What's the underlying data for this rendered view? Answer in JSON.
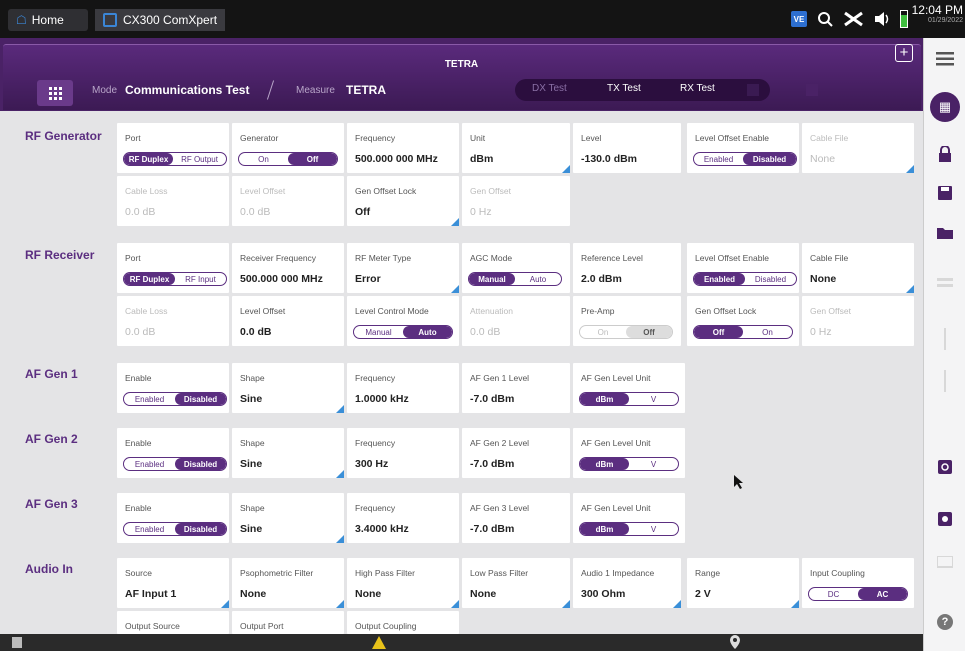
{
  "os": {
    "home_label": "Home",
    "app_label": "CX300 ComXpert",
    "time": "12:04 PM",
    "date": "01/29/2022"
  },
  "header": {
    "title": "TETRA",
    "mode_label": "Mode",
    "mode_value": "Communications Test",
    "measure_label": "Measure",
    "measure_value": "TETRA",
    "tabs": [
      "DX Test",
      "TX Test",
      "RX Test"
    ]
  },
  "sections": {
    "rf_generator": "RF Generator",
    "rf_receiver": "RF Receiver",
    "af_gen1": "AF Gen 1",
    "af_gen2": "AF Gen 2",
    "af_gen3": "AF Gen 3",
    "audio_in": "Audio In"
  },
  "rfgen": {
    "port": {
      "label": "Port",
      "opts": [
        "RF Duplex",
        "RF Output"
      ]
    },
    "generator": {
      "label": "Generator",
      "opts": [
        "On",
        "Off"
      ]
    },
    "frequency": {
      "label": "Frequency",
      "value": "500.000 000 MHz"
    },
    "unit": {
      "label": "Unit",
      "value": "dBm"
    },
    "level": {
      "label": "Level",
      "value": "-130.0 dBm"
    },
    "level_offset_enable": {
      "label": "Level Offset Enable",
      "opts": [
        "Enabled",
        "Disabled"
      ]
    },
    "cable_file": {
      "label": "Cable File",
      "value": "None"
    },
    "cable_loss": {
      "label": "Cable Loss",
      "value": "0.0 dB"
    },
    "level_offset": {
      "label": "Level Offset",
      "value": "0.0 dB"
    },
    "gen_offset_lock": {
      "label": "Gen Offset Lock",
      "value": "Off"
    },
    "gen_offset": {
      "label": "Gen Offset",
      "value": "0 Hz"
    }
  },
  "rfrec": {
    "port": {
      "label": "Port",
      "opts": [
        "RF Duplex",
        "RF Input"
      ]
    },
    "receiver_frequency": {
      "label": "Receiver Frequency",
      "value": "500.000 000 MHz"
    },
    "meter_type": {
      "label": "RF Meter Type",
      "value": "Error"
    },
    "agc_mode": {
      "label": "AGC Mode",
      "opts": [
        "Manual",
        "Auto"
      ]
    },
    "reference_level": {
      "label": "Reference Level",
      "value": "2.0 dBm"
    },
    "level_offset_enable": {
      "label": "Level Offset Enable",
      "opts": [
        "Enabled",
        "Disabled"
      ]
    },
    "cable_file": {
      "label": "Cable File",
      "value": "None"
    },
    "cable_loss": {
      "label": "Cable Loss",
      "value": "0.0 dB"
    },
    "level_offset": {
      "label": "Level Offset",
      "value": "0.0 dB"
    },
    "level_control_mode": {
      "label": "Level Control Mode",
      "opts": [
        "Manual",
        "Auto"
      ]
    },
    "attenuation": {
      "label": "Attenuation",
      "value": "0.0 dB"
    },
    "pre_amp": {
      "label": "Pre-Amp",
      "opts": [
        "On",
        "Off"
      ]
    },
    "gen_offset_lock": {
      "label": "Gen Offset Lock",
      "opts": [
        "Off",
        "On"
      ]
    },
    "gen_offset": {
      "label": "Gen Offset",
      "value": "0 Hz"
    }
  },
  "afgen1": {
    "enable": {
      "label": "Enable",
      "opts": [
        "Enabled",
        "Disabled"
      ]
    },
    "shape": {
      "label": "Shape",
      "value": "Sine"
    },
    "frequency": {
      "label": "Frequency",
      "value": "1.0000 kHz"
    },
    "level": {
      "label": "AF Gen 1 Level",
      "value": "-7.0 dBm"
    },
    "unit": {
      "label": "AF Gen Level Unit",
      "opts": [
        "dBm",
        "V"
      ]
    }
  },
  "afgen2": {
    "enable": {
      "label": "Enable",
      "opts": [
        "Enabled",
        "Disabled"
      ]
    },
    "shape": {
      "label": "Shape",
      "value": "Sine"
    },
    "frequency": {
      "label": "Frequency",
      "value": "300 Hz"
    },
    "level": {
      "label": "AF Gen 2 Level",
      "value": "-7.0 dBm"
    },
    "unit": {
      "label": "AF Gen Level Unit",
      "opts": [
        "dBm",
        "V"
      ]
    }
  },
  "afgen3": {
    "enable": {
      "label": "Enable",
      "opts": [
        "Enabled",
        "Disabled"
      ]
    },
    "shape": {
      "label": "Shape",
      "value": "Sine"
    },
    "frequency": {
      "label": "Frequency",
      "value": "3.4000 kHz"
    },
    "level": {
      "label": "AF Gen 3 Level",
      "value": "-7.0 dBm"
    },
    "unit": {
      "label": "AF Gen Level Unit",
      "opts": [
        "dBm",
        "V"
      ]
    }
  },
  "audioin": {
    "source": {
      "label": "Source",
      "value": "AF Input 1"
    },
    "psophometric": {
      "label": "Psophometric Filter",
      "value": "None"
    },
    "hpf": {
      "label": "High Pass Filter",
      "value": "None"
    },
    "lpf": {
      "label": "Low Pass Filter",
      "value": "None"
    },
    "impedance": {
      "label": "Audio 1 Impedance",
      "value": "300 Ohm"
    },
    "range": {
      "label": "Range",
      "value": "2 V"
    },
    "coupling": {
      "label": "Input Coupling",
      "opts": [
        "DC",
        "AC"
      ]
    },
    "output_source": {
      "label": "Output Source"
    },
    "output_port": {
      "label": "Output Port"
    },
    "output_coupling": {
      "label": "Output Coupling"
    }
  },
  "colors": {
    "accent": "#5b2e80",
    "header": "#4a2266",
    "link": "#3a8fd8"
  },
  "sidebar_icons": [
    "menu-icon",
    "apps-icon",
    "lock-icon",
    "save-icon",
    "folder-icon",
    "keypad-icon",
    "probe-icon",
    "usb-icon",
    "search-icon",
    "settings-icon",
    "monitor-icon",
    "help-icon"
  ]
}
